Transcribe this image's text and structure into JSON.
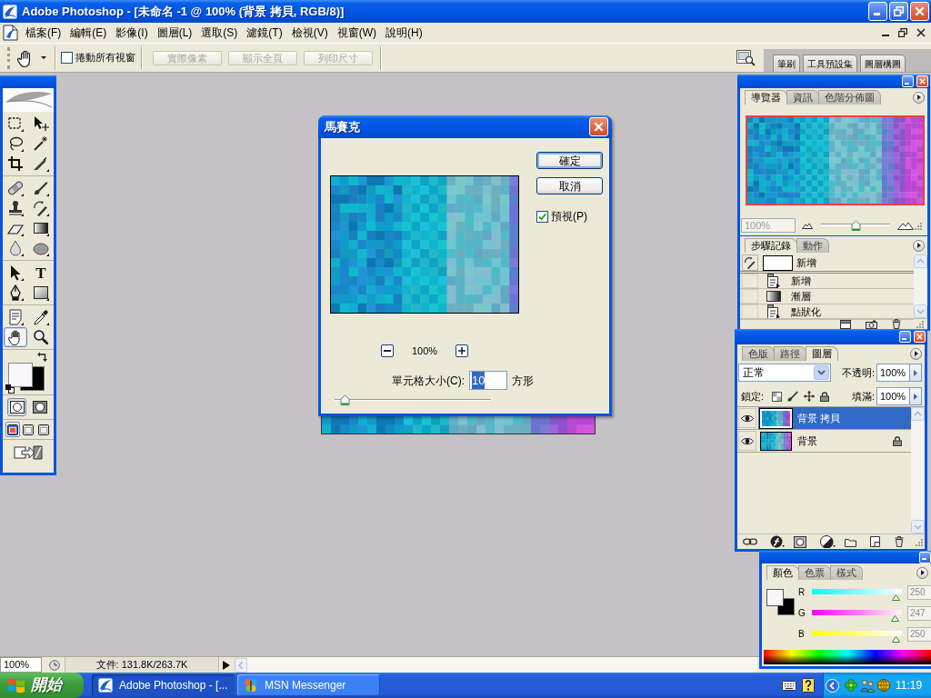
{
  "window": {
    "title": "Adobe Photoshop - [未命名 -1 @ 100% (背景 拷貝, RGB/8)]"
  },
  "menu": [
    "檔案(F)",
    "編輯(E)",
    "影像(I)",
    "圖層(L)",
    "選取(S)",
    "濾鏡(T)",
    "檢視(V)",
    "視窗(W)",
    "說明(H)"
  ],
  "options_bar": {
    "scroll_all": {
      "label": "捲動所有視窗",
      "checked": false
    },
    "buttons": [
      {
        "label": "實際像素",
        "disabled": true
      },
      {
        "label": "顯示全頁",
        "disabled": true
      },
      {
        "label": "列印尺寸",
        "disabled": true
      }
    ],
    "palette_well": [
      "筆刷",
      "工具預設集",
      "圖層構圖"
    ]
  },
  "toolbox": {
    "tool_groups": [
      {
        "tools": [
          {
            "selected": false
          },
          {
            "selected": false
          },
          {
            "selected": false
          },
          {
            "selected": false
          },
          {
            "selected": false
          },
          {
            "selected": false
          }
        ]
      },
      {
        "tools": [
          {
            "selected": false
          },
          {
            "selected": false
          },
          {
            "selected": false
          },
          {
            "selected": false
          },
          {
            "selected": false
          },
          {
            "selected": false
          },
          {
            "selected": false
          },
          {
            "selected": false
          }
        ]
      },
      {
        "tools": [
          {
            "selected": false
          },
          {
            "selected": false,
            "glyph": "T"
          },
          {
            "selected": false
          },
          {
            "selected": false
          }
        ]
      },
      {
        "tools": [
          {
            "selected": false
          },
          {
            "selected": false
          },
          {
            "selected": true
          },
          {
            "selected": false
          }
        ]
      }
    ],
    "mask_modes": [
      {
        "selected": true
      },
      {
        "selected": false
      }
    ],
    "screen_modes": [
      {
        "selected": true
      },
      {
        "selected": false
      },
      {
        "selected": false
      }
    ]
  },
  "dialog": {
    "title": "馬賽克",
    "buttons": [
      {
        "label": "確定",
        "default": true
      },
      {
        "label": "取消",
        "default": false
      }
    ],
    "preview": {
      "label": "預視(P)",
      "checked": true
    },
    "zoom": "100%",
    "cell_size": {
      "label": "單元格大小(C):",
      "value": "10",
      "value_selected": true,
      "unit": "方形"
    },
    "slider": {
      "level": 0.04
    }
  },
  "navigator": {
    "tabs": [
      {
        "label": "導覽器",
        "selected": true
      },
      {
        "label": "資訊",
        "selected": false
      },
      {
        "label": "色階分佈圖",
        "selected": false
      }
    ],
    "zoom": "100%",
    "zoom_slider": {
      "level": 0.5
    }
  },
  "history": {
    "tabs": [
      {
        "label": "步驟記錄",
        "selected": true
      },
      {
        "label": "動作",
        "selected": false
      }
    ],
    "snapshot": "新增",
    "steps": [
      {
        "label": "新增",
        "kind": "document"
      },
      {
        "label": "漸層",
        "kind": "gradient"
      },
      {
        "label": "點狀化",
        "kind": "document"
      }
    ]
  },
  "layers": {
    "tabs": [
      {
        "label": "色版",
        "selected": false
      },
      {
        "label": "路徑",
        "selected": false
      },
      {
        "label": "圖層",
        "selected": true
      }
    ],
    "blend_mode": "正常",
    "opacity_label": "不透明:",
    "opacity": "100%",
    "lock_label": "鎖定:",
    "fill_label": "填滿:",
    "fill": "100%",
    "items": [
      {
        "name": "背景 拷貝",
        "visible": true,
        "locked": false,
        "selected": true
      },
      {
        "name": "背景",
        "visible": true,
        "locked": true,
        "selected": false
      }
    ]
  },
  "color": {
    "tabs": [
      {
        "label": "顏色",
        "selected": true
      },
      {
        "label": "色票",
        "selected": false
      },
      {
        "label": "樣式",
        "selected": false
      }
    ],
    "channels": [
      {
        "name": "R",
        "value": "250",
        "level": 0.98
      },
      {
        "name": "G",
        "value": "247",
        "level": 0.97
      },
      {
        "name": "B",
        "value": "250",
        "level": 0.98
      }
    ]
  },
  "status_bar": {
    "zoom": "100%",
    "doc_info": "文件: 131.8K/263.7K"
  },
  "taskbar": {
    "start": "開始",
    "tasks": [
      {
        "label": "Adobe Photoshop - [...",
        "selected": true
      },
      {
        "label": "MSN Messenger",
        "selected": false
      }
    ],
    "clock": "11:19"
  }
}
